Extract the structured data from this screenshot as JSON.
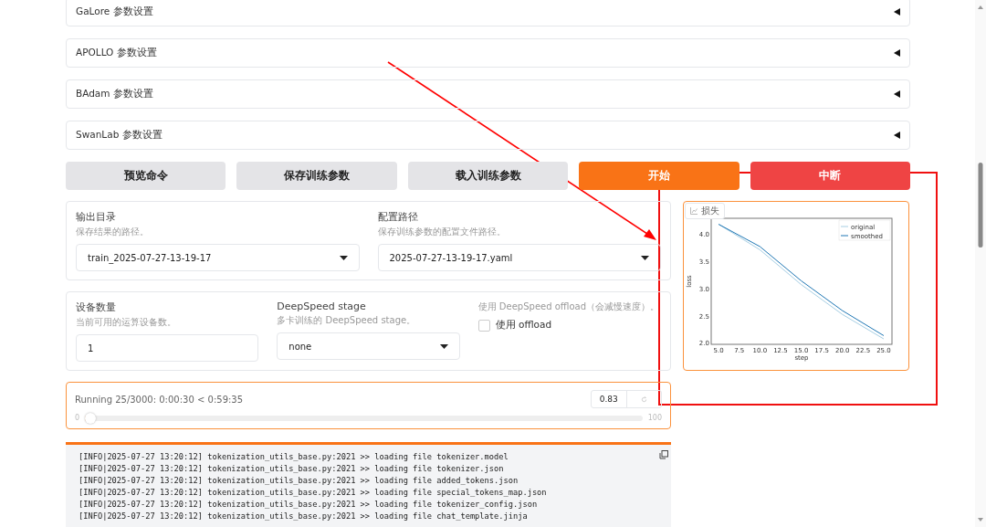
{
  "accordions": [
    {
      "title": "GaLore 参数设置",
      "expanded": false
    },
    {
      "title": "APOLLO 参数设置",
      "expanded": false
    },
    {
      "title": "BAdam 参数设置",
      "expanded": false
    },
    {
      "title": "SwanLab 参数设置",
      "expanded": false
    }
  ],
  "actions": [
    {
      "label": "预览命令",
      "kind": "secondary"
    },
    {
      "label": "保存训练参数",
      "kind": "secondary"
    },
    {
      "label": "载入训练参数",
      "kind": "secondary"
    },
    {
      "label": "开始",
      "kind": "primary"
    },
    {
      "label": "中断",
      "kind": "stop"
    }
  ],
  "paths": {
    "output_dir": {
      "label": "输出目录",
      "info": "保存结果的路径。",
      "value": "train_2025-07-27-13-19-17"
    },
    "config_path": {
      "label": "配置路径",
      "info": "保存训练参数的配置文件路径。",
      "value": "2025-07-27-13-19-17.yaml"
    }
  },
  "devices": {
    "device_count": {
      "label": "设备数量",
      "info": "当前可用的运算设备数。",
      "value": "1"
    },
    "ds_stage": {
      "label": "DeepSpeed stage",
      "info": "多卡训练的 DeepSpeed stage。",
      "value": "none"
    },
    "ds_offload": {
      "info": "使用 DeepSpeed offload（会减慢速度）。",
      "label": "使用 offload",
      "checked": false
    }
  },
  "progress": {
    "status": "Running 25/3000: 0:00:30 < 0:59:35",
    "value": "0.83",
    "min": "0",
    "max": "100",
    "level": 0.0083
  },
  "loss_plot": {
    "label": "损失",
    "chart_data": {
      "type": "line",
      "xlabel": "step",
      "ylabel": "loss",
      "x": [
        5,
        10,
        15,
        20,
        25
      ],
      "series": [
        {
          "name": "original",
          "color": "#a6cee3",
          "values": [
            4.19,
            3.72,
            3.08,
            2.53,
            2.08
          ]
        },
        {
          "name": "smoothed",
          "color": "#1f77b4",
          "values": [
            4.19,
            3.78,
            3.15,
            2.6,
            2.14
          ]
        }
      ],
      "legend": true,
      "xlim": [
        4.1,
        26
      ],
      "ylim": [
        1.98,
        4.3
      ],
      "xticks": [
        {
          "value": 5,
          "label": "5.0"
        },
        {
          "value": 7.5,
          "label": "7.5"
        },
        {
          "value": 10,
          "label": "10.0"
        },
        {
          "value": 12.5,
          "label": "12.5"
        },
        {
          "value": 15,
          "label": "15.0"
        },
        {
          "value": 17.5,
          "label": "17.5"
        },
        {
          "value": 20,
          "label": "20.0"
        },
        {
          "value": 22.5,
          "label": "22.5"
        },
        {
          "value": 25,
          "label": "25.0"
        }
      ],
      "yticks": [
        {
          "value": 2,
          "label": "2.0"
        },
        {
          "value": 2.5,
          "label": "2.5"
        },
        {
          "value": 3,
          "label": "3.0"
        },
        {
          "value": 3.5,
          "label": "3.5"
        },
        {
          "value": 4,
          "label": "4.0"
        }
      ]
    }
  },
  "log_lines": [
    "[INFO|2025-07-27 13:20:12] tokenization_utils_base.py:2021 >> loading file tokenizer.model",
    "[INFO|2025-07-27 13:20:12] tokenization_utils_base.py:2021 >> loading file tokenizer.json",
    "[INFO|2025-07-27 13:20:12] tokenization_utils_base.py:2021 >> loading file added_tokens.json",
    "[INFO|2025-07-27 13:20:12] tokenization_utils_base.py:2021 >> loading file special_tokens_map.json",
    "[INFO|2025-07-27 13:20:12] tokenization_utils_base.py:2021 >> loading file tokenizer_config.json",
    "[INFO|2025-07-27 13:20:12] tokenization_utils_base.py:2021 >> loading file chat_template.jinja"
  ]
}
